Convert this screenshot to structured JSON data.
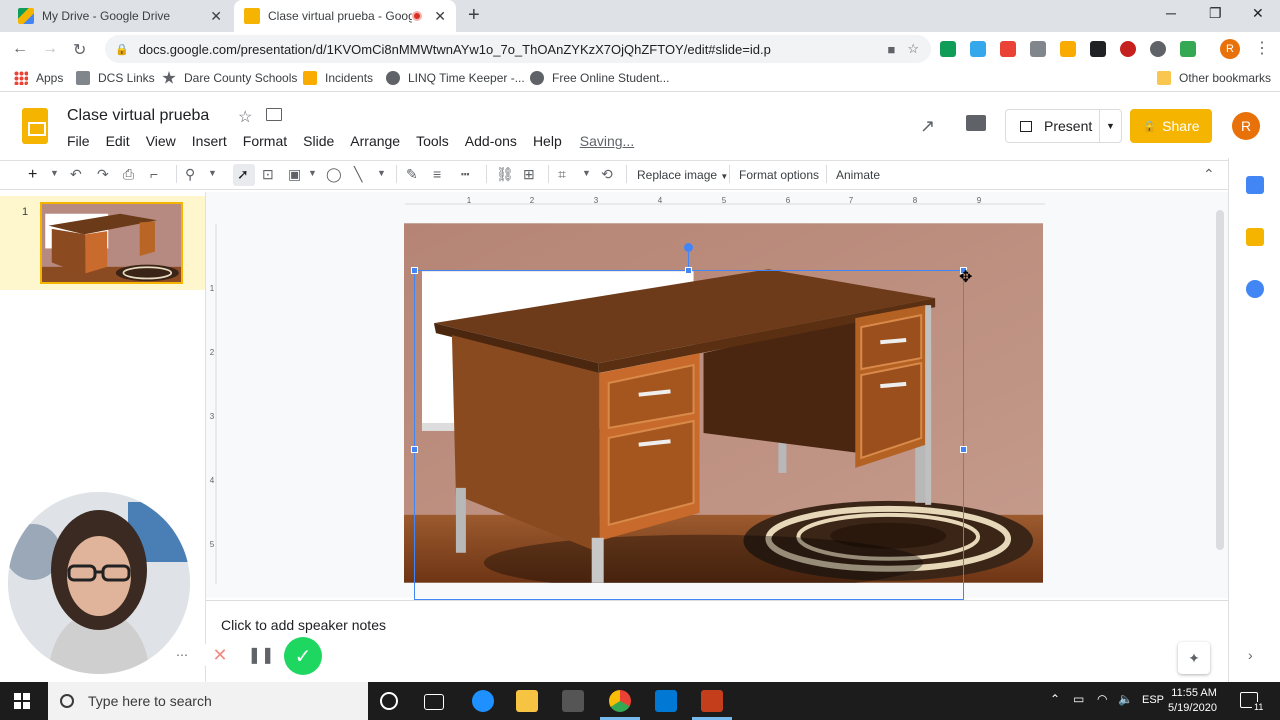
{
  "browser": {
    "tabs": [
      {
        "label": "My Drive - Google Drive",
        "active": false
      },
      {
        "label": "Clase virtual prueba - Google",
        "active": true
      }
    ],
    "url": "docs.google.com/presentation/d/1KVOmCi8nMMWtwnAYw1o_7o_ThOAnZYKzX7OjQhZFTOY/edit#slide=id.p",
    "bookmarks": [
      "Apps",
      "DCS Links",
      "Dare County Schools",
      "Incidents",
      "LINQ Time Keeper -...",
      "Free Online Student...",
      "Other bookmarks"
    ],
    "profile_initial": "R"
  },
  "app": {
    "title": "Clase virtual prueba",
    "menu": [
      "File",
      "Edit",
      "View",
      "Insert",
      "Format",
      "Slide",
      "Arrange",
      "Tools",
      "Add-ons",
      "Help"
    ],
    "status": "Saving...",
    "present_label": "Present",
    "share_label": "Share",
    "user_initial": "R"
  },
  "toolbar": {
    "replace_image": "Replace image",
    "format_options": "Format options",
    "animate": "Animate"
  },
  "ruler": {
    "top": [
      "1",
      "2",
      "3",
      "4",
      "5",
      "6",
      "7",
      "8",
      "9"
    ],
    "left": [
      "1",
      "2",
      "3",
      "4",
      "5"
    ]
  },
  "filmstrip": {
    "slides": [
      {
        "number": "1"
      }
    ]
  },
  "notes": {
    "placeholder": "Click to add speaker notes"
  },
  "taskbar": {
    "search_placeholder": "Type here to search",
    "language": "ESP",
    "time": "11:55 AM",
    "date": "5/19/2020",
    "notifications": "11"
  },
  "colors": {
    "slides_yellow": "#f4b400",
    "selection_blue": "#4285f4",
    "record_green": "#1ed760"
  }
}
